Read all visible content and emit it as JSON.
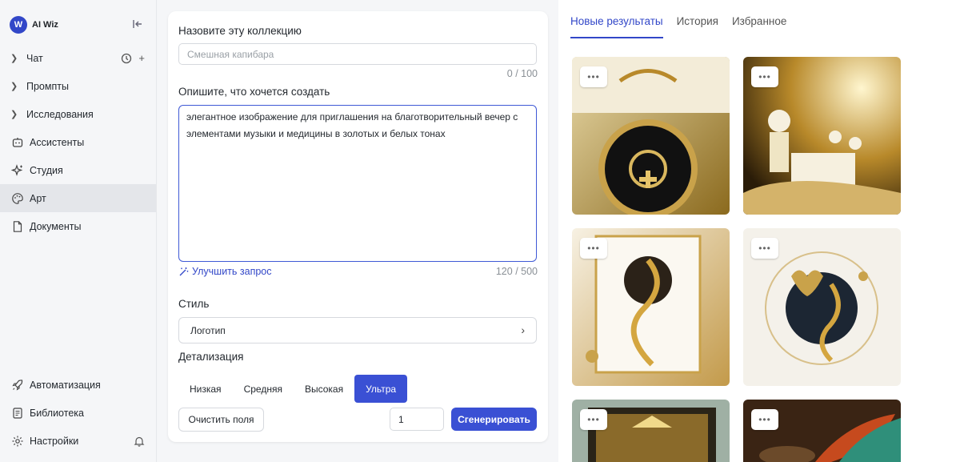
{
  "app": {
    "name": "AI Wiz"
  },
  "sidebar": {
    "items": [
      {
        "label": "Чат"
      },
      {
        "label": "Промпты"
      },
      {
        "label": "Исследования"
      },
      {
        "label": "Ассистенты"
      },
      {
        "label": "Студия"
      },
      {
        "label": "Арт"
      },
      {
        "label": "Документы"
      }
    ],
    "bottom": [
      {
        "label": "Автоматизация"
      },
      {
        "label": "Библиотека"
      },
      {
        "label": "Настройки"
      }
    ]
  },
  "form": {
    "name_label": "Назовите эту коллекцию",
    "name_placeholder": "Смешная капибара",
    "name_counter": "0 / 100",
    "desc_label": "Опишите, что хочется создать",
    "desc_value": "элегантное изображение для приглашения на благотворительный вечер с элементами музыки и медицины в золотых и белых тонах",
    "desc_counter": "120 / 500",
    "improve_label": "Улучшить запрос",
    "style_label": "Стиль",
    "style_value": "Логотип",
    "detail_label": "Детализация",
    "detail_options": [
      "Низкая",
      "Средняя",
      "Высокая",
      "Ультра"
    ],
    "detail_selected": "Ультра",
    "clear_label": "Очистить поля",
    "quantity": "1",
    "generate_label": "Сгенерировать"
  },
  "results": {
    "tabs": [
      "Новые результаты",
      "История",
      "Избранное"
    ],
    "active_tab": "Новые результаты",
    "menu_glyph": "•••"
  },
  "colors": {
    "accent": "#3a50d4",
    "gold": "#c9a24a"
  }
}
